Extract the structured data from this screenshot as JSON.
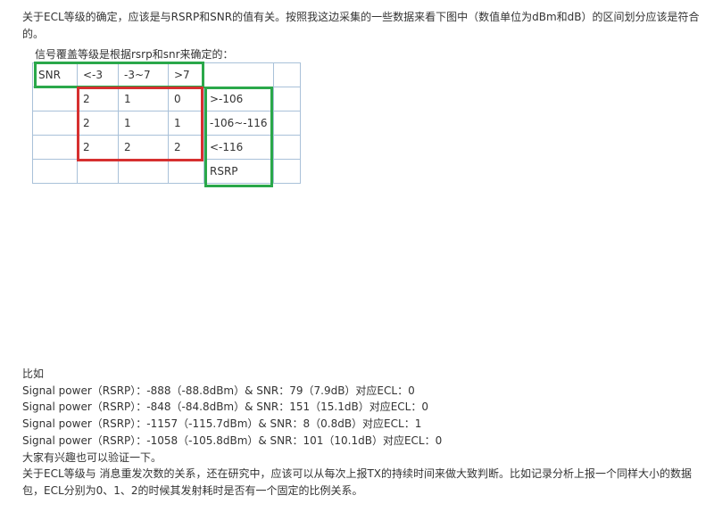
{
  "intro": "关于ECL等级的确定，应该是与RSRP和SNR的值有关。按照我这边采集的一些数据来看下图中（数值单位为dBm和dB）的区间划分应该是符合的。",
  "table_caption": "信号覆盖等级是根据rsrp和snr来确定的：",
  "table": {
    "rows": [
      [
        "SNR",
        "<-3",
        "-3~7",
        ">7",
        "",
        ""
      ],
      [
        "",
        "2",
        "1",
        "0",
        ">-106",
        ""
      ],
      [
        "",
        "2",
        "1",
        "1",
        "-106~-116",
        ""
      ],
      [
        "",
        "2",
        "2",
        "2",
        "<-116",
        ""
      ],
      [
        "",
        "",
        "",
        "",
        "RSRP",
        ""
      ]
    ]
  },
  "highlight_colors": {
    "green": "#2aa84a",
    "red": "#d63030"
  },
  "example": {
    "heading": "比如",
    "lines": [
      "Signal power（RSRP）：-888（-88.8dBm）& SNR：79（7.9dB）对应ECL：0",
      "Signal power（RSRP）：-848（-84.8dBm）& SNR：151（15.1dB）对应ECL：0",
      "Signal power（RSRP）：-1157（-115.7dBm）& SNR：8（0.8dB）对应ECL：1",
      "Signal power（RSRP）：-1058（-105.8dBm）& SNR：101（10.1dB）对应ECL：0"
    ],
    "verify": "大家有兴趣也可以验证一下。",
    "closing": "关于ECL等级与 消息重发次数的关系，还在研究中，应该可以从每次上报TX的持续时间来做大致判断。比如记录分析上报一个同样大小的数据包，ECL分别为0、1、2的时候其发射耗时是否有一个固定的比例关系。"
  }
}
